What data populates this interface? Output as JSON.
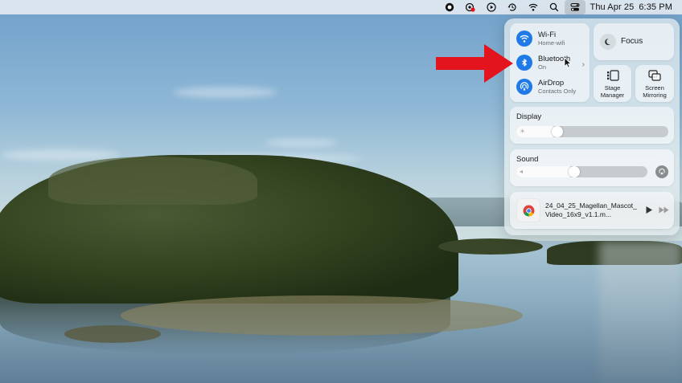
{
  "menubar": {
    "icons": [
      "record-icon",
      "vpn-icon",
      "play-circle-icon",
      "time-machine-icon",
      "wifi-icon",
      "search-icon",
      "control-center-icon"
    ],
    "date": "Thu Apr 25",
    "time": "6:35 PM"
  },
  "control_center": {
    "wifi": {
      "title": "Wi-Fi",
      "subtitle": "Home-wifi"
    },
    "bluetooth": {
      "title": "Bluetooth",
      "subtitle": "On"
    },
    "airdrop": {
      "title": "AirDrop",
      "subtitle": "Contacts Only"
    },
    "focus": {
      "label": "Focus"
    },
    "stage_manager": {
      "label_line1": "Stage",
      "label_line2": "Manager"
    },
    "screen_mirroring": {
      "label_line1": "Screen",
      "label_line2": "Mirroring"
    },
    "display": {
      "title": "Display",
      "level": 0.27
    },
    "sound": {
      "title": "Sound",
      "level": 0.44
    },
    "now_playing": {
      "track": "24_04_25_Magellan_Mascot_Video_16x9_v1.1.m..."
    }
  },
  "colors": {
    "accent": "#1f7ae8",
    "annotation_arrow": "#e3141d"
  }
}
